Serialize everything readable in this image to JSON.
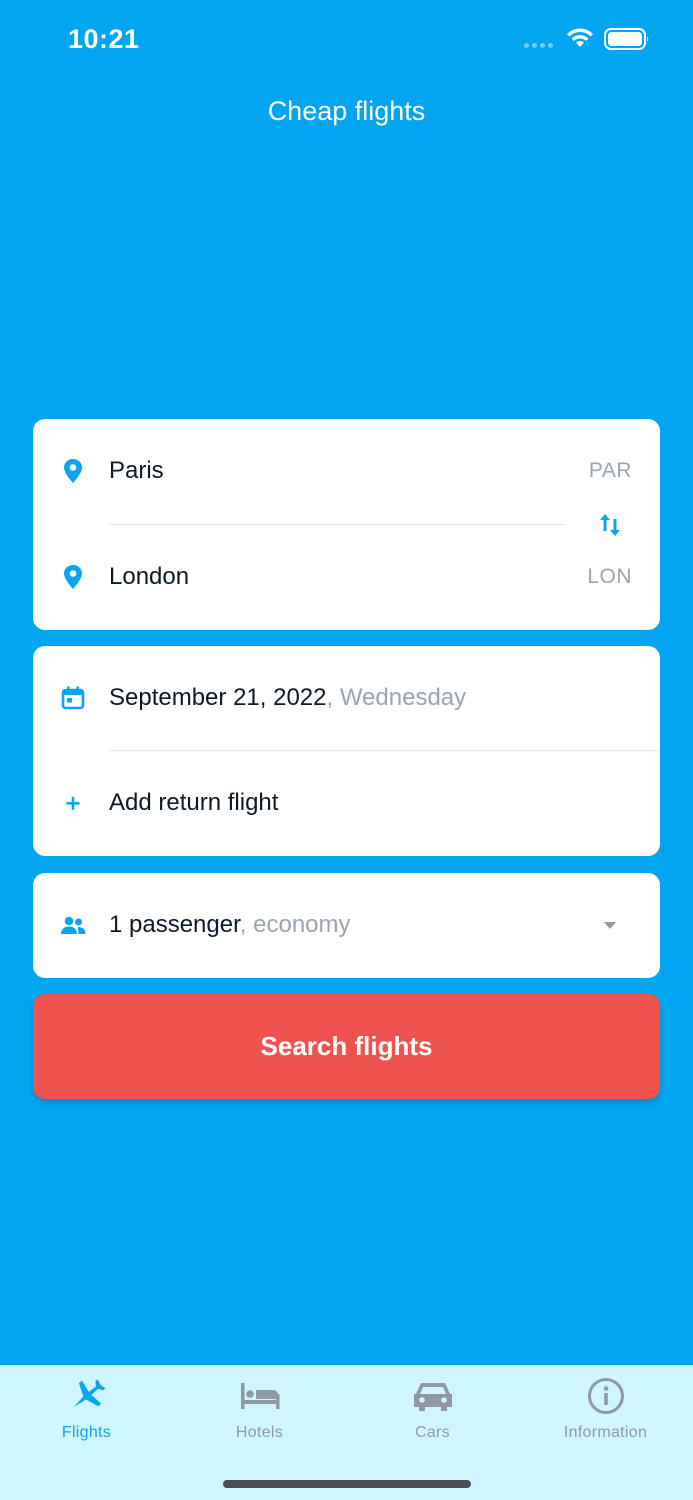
{
  "status_bar": {
    "time": "10:21"
  },
  "header": {
    "title": "Cheap flights"
  },
  "route": {
    "origin": {
      "city": "Paris",
      "code": "PAR"
    },
    "destination": {
      "city": "London",
      "code": "LON"
    }
  },
  "dates": {
    "departure_date": "September 21, 2022",
    "departure_weekday": ", Wednesday",
    "add_return_label": "Add return flight"
  },
  "passengers": {
    "count_label": "1 passenger",
    "class_label": ", economy"
  },
  "search": {
    "button_label": "Search flights"
  },
  "tabs": [
    {
      "label": "Flights",
      "icon": "airplane-icon",
      "active": true
    },
    {
      "label": "Hotels",
      "icon": "bed-icon",
      "active": false
    },
    {
      "label": "Cars",
      "icon": "car-icon",
      "active": false
    },
    {
      "label": "Information",
      "icon": "info-icon",
      "active": false
    }
  ],
  "colors": {
    "background": "#04A5F0",
    "accent": "#0AA4EF",
    "search_button": "#EF5350",
    "tab_bar": "#CFF6FE",
    "muted_text": "#98A4B1"
  }
}
